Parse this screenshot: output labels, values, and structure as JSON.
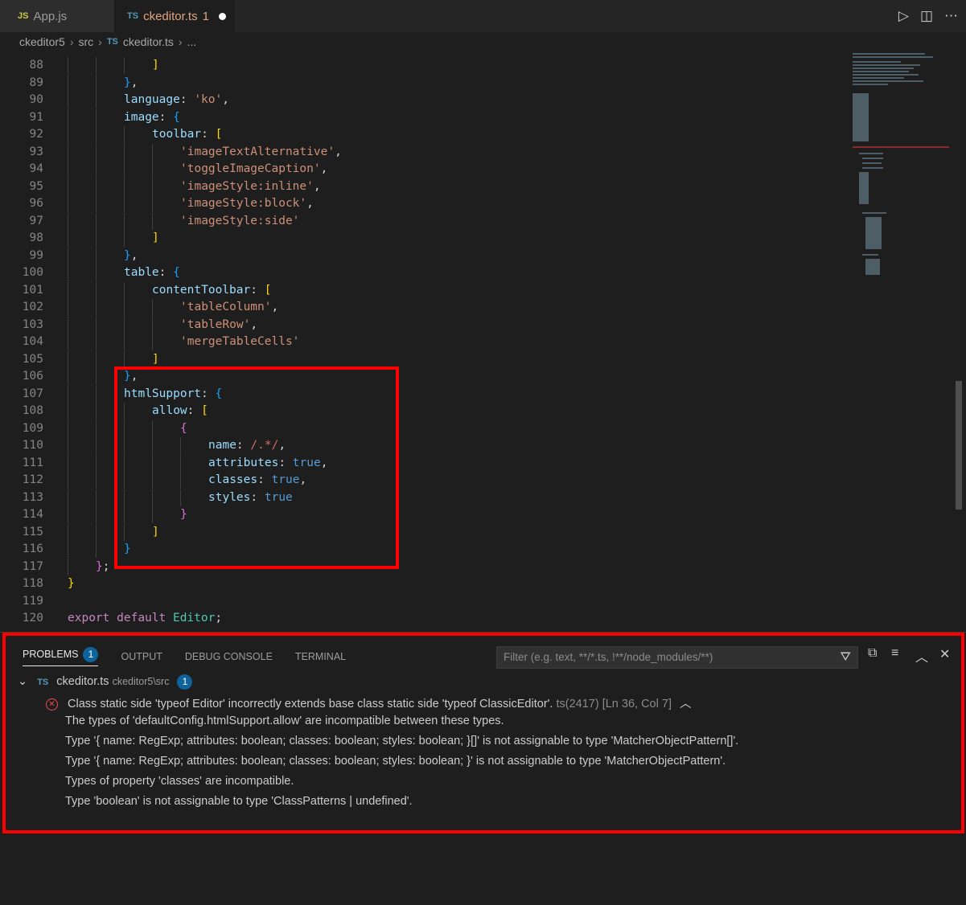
{
  "tabs": [
    {
      "lang": "JS",
      "label": "App.js"
    },
    {
      "lang": "TS",
      "label": "ckeditor.ts",
      "count": "1"
    }
  ],
  "breadcrumb": {
    "items": [
      "ckeditor5",
      "src",
      "ckeditor.ts",
      "..."
    ],
    "file_lang": "TS"
  },
  "editor": {
    "lines": [
      {
        "n": "88",
        "indent": 3,
        "tokens": [
          [
            "b1",
            "]"
          ]
        ]
      },
      {
        "n": "89",
        "indent": 2,
        "tokens": [
          [
            "b3",
            "}"
          ],
          [
            "p",
            ","
          ]
        ]
      },
      {
        "n": "90",
        "indent": 2,
        "tokens": [
          [
            "k",
            "language"
          ],
          [
            "p",
            ": "
          ],
          [
            "s",
            "'ko'"
          ],
          [
            "p",
            ","
          ]
        ]
      },
      {
        "n": "91",
        "indent": 2,
        "tokens": [
          [
            "k",
            "image"
          ],
          [
            "p",
            ": "
          ],
          [
            "b3",
            "{"
          ]
        ]
      },
      {
        "n": "92",
        "indent": 3,
        "tokens": [
          [
            "k",
            "toolbar"
          ],
          [
            "p",
            ": "
          ],
          [
            "b1",
            "["
          ]
        ]
      },
      {
        "n": "93",
        "indent": 4,
        "tokens": [
          [
            "s",
            "'imageTextAlternative'"
          ],
          [
            "p",
            ","
          ]
        ]
      },
      {
        "n": "94",
        "indent": 4,
        "tokens": [
          [
            "s",
            "'toggleImageCaption'"
          ],
          [
            "p",
            ","
          ]
        ]
      },
      {
        "n": "95",
        "indent": 4,
        "tokens": [
          [
            "s",
            "'imageStyle:inline'"
          ],
          [
            "p",
            ","
          ]
        ]
      },
      {
        "n": "96",
        "indent": 4,
        "tokens": [
          [
            "s",
            "'imageStyle:block'"
          ],
          [
            "p",
            ","
          ]
        ]
      },
      {
        "n": "97",
        "indent": 4,
        "tokens": [
          [
            "s",
            "'imageStyle:side'"
          ]
        ]
      },
      {
        "n": "98",
        "indent": 3,
        "tokens": [
          [
            "b1",
            "]"
          ]
        ]
      },
      {
        "n": "99",
        "indent": 2,
        "tokens": [
          [
            "b3",
            "}"
          ],
          [
            "p",
            ","
          ]
        ]
      },
      {
        "n": "100",
        "indent": 2,
        "tokens": [
          [
            "k",
            "table"
          ],
          [
            "p",
            ": "
          ],
          [
            "b3",
            "{"
          ]
        ]
      },
      {
        "n": "101",
        "indent": 3,
        "tokens": [
          [
            "k",
            "contentToolbar"
          ],
          [
            "p",
            ": "
          ],
          [
            "b1",
            "["
          ]
        ]
      },
      {
        "n": "102",
        "indent": 4,
        "tokens": [
          [
            "s",
            "'tableColumn'"
          ],
          [
            "p",
            ","
          ]
        ]
      },
      {
        "n": "103",
        "indent": 4,
        "tokens": [
          [
            "s",
            "'tableRow'"
          ],
          [
            "p",
            ","
          ]
        ]
      },
      {
        "n": "104",
        "indent": 4,
        "tokens": [
          [
            "s",
            "'mergeTableCells'"
          ]
        ]
      },
      {
        "n": "105",
        "indent": 3,
        "tokens": [
          [
            "b1",
            "]"
          ]
        ]
      },
      {
        "n": "106",
        "indent": 2,
        "tokens": [
          [
            "b3",
            "}"
          ],
          [
            "p",
            ","
          ]
        ]
      },
      {
        "n": "107",
        "indent": 2,
        "tokens": [
          [
            "k",
            "htmlSupport"
          ],
          [
            "p",
            ": "
          ],
          [
            "b3",
            "{"
          ]
        ]
      },
      {
        "n": "108",
        "indent": 3,
        "tokens": [
          [
            "k",
            "allow"
          ],
          [
            "p",
            ": "
          ],
          [
            "b1",
            "["
          ]
        ]
      },
      {
        "n": "109",
        "indent": 4,
        "tokens": [
          [
            "b2",
            "{"
          ]
        ]
      },
      {
        "n": "110",
        "indent": 5,
        "tokens": [
          [
            "k",
            "name"
          ],
          [
            "p",
            ": "
          ],
          [
            "re",
            "/.*/"
          ],
          [
            "p",
            ","
          ]
        ]
      },
      {
        "n": "111",
        "indent": 5,
        "tokens": [
          [
            "k",
            "attributes"
          ],
          [
            "p",
            ": "
          ],
          [
            "bool",
            "true"
          ],
          [
            "p",
            ","
          ]
        ]
      },
      {
        "n": "112",
        "indent": 5,
        "tokens": [
          [
            "k",
            "classes"
          ],
          [
            "p",
            ": "
          ],
          [
            "bool",
            "true"
          ],
          [
            "p",
            ","
          ]
        ]
      },
      {
        "n": "113",
        "indent": 5,
        "tokens": [
          [
            "k",
            "styles"
          ],
          [
            "p",
            ": "
          ],
          [
            "bool",
            "true"
          ]
        ]
      },
      {
        "n": "114",
        "indent": 4,
        "tokens": [
          [
            "b2",
            "}"
          ]
        ]
      },
      {
        "n": "115",
        "indent": 3,
        "tokens": [
          [
            "b1",
            "]"
          ]
        ]
      },
      {
        "n": "116",
        "indent": 2,
        "tokens": [
          [
            "b3",
            "}"
          ]
        ]
      },
      {
        "n": "117",
        "indent": 1,
        "tokens": [
          [
            "b2",
            "}"
          ],
          [
            "p",
            ";"
          ]
        ]
      },
      {
        "n": "118",
        "indent": 0,
        "tokens": [
          [
            "b1",
            "}"
          ]
        ]
      },
      {
        "n": "119",
        "indent": 0,
        "tokens": []
      },
      {
        "n": "120",
        "indent": 0,
        "tokens": [
          [
            "kw",
            "export"
          ],
          [
            "p",
            " "
          ],
          [
            "kw",
            "default"
          ],
          [
            "p",
            " "
          ],
          [
            "cls",
            "Editor"
          ],
          [
            "p",
            ";"
          ]
        ]
      }
    ]
  },
  "panel": {
    "tabs": [
      "PROBLEMS",
      "OUTPUT",
      "DEBUG CONSOLE",
      "TERMINAL"
    ],
    "problems_count": "1",
    "filter_placeholder": "Filter (e.g. text, **/*.ts, !**/node_modules/**)",
    "file": {
      "lang": "TS",
      "name": "ckeditor.ts",
      "path": "ckeditor5\\src",
      "count": "1"
    },
    "error": {
      "message": "Class static side 'typeof Editor' incorrectly extends base class static side 'typeof ClassicEditor'.",
      "code": "ts(2417)",
      "location": "[Ln 36, Col 7]"
    },
    "details": [
      "The types of 'defaultConfig.htmlSupport.allow' are incompatible between these types.",
      "Type '{ name: RegExp; attributes: boolean; classes: boolean; styles: boolean; }[]' is not assignable to type 'MatcherObjectPattern[]'.",
      "Type '{ name: RegExp; attributes: boolean; classes: boolean; styles: boolean; }' is not assignable to type 'MatcherObjectPattern'.",
      "Types of property 'classes' are incompatible.",
      "Type 'boolean' is not assignable to type 'ClassPatterns | undefined'."
    ]
  },
  "colors": {
    "highlight": "#ff0000",
    "accent": "#0e639c",
    "error": "#f14c4c"
  }
}
